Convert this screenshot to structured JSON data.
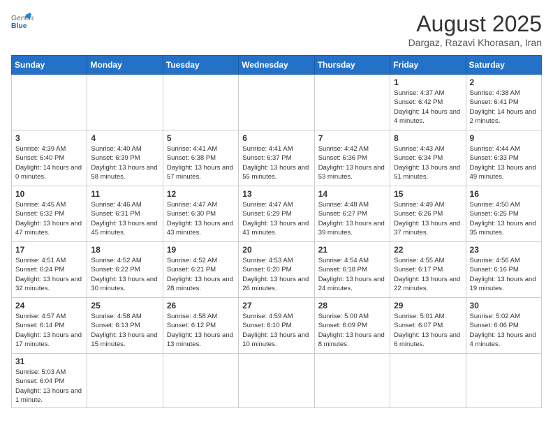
{
  "header": {
    "logo_general": "General",
    "logo_blue": "Blue",
    "title": "August 2025",
    "subtitle": "Dargaz, Razavi Khorasan, Iran"
  },
  "weekdays": [
    "Sunday",
    "Monday",
    "Tuesday",
    "Wednesday",
    "Thursday",
    "Friday",
    "Saturday"
  ],
  "weeks": [
    [
      {
        "day": "",
        "info": ""
      },
      {
        "day": "",
        "info": ""
      },
      {
        "day": "",
        "info": ""
      },
      {
        "day": "",
        "info": ""
      },
      {
        "day": "",
        "info": ""
      },
      {
        "day": "1",
        "info": "Sunrise: 4:37 AM\nSunset: 6:42 PM\nDaylight: 14 hours\nand 4 minutes."
      },
      {
        "day": "2",
        "info": "Sunrise: 4:38 AM\nSunset: 6:41 PM\nDaylight: 14 hours\nand 2 minutes."
      }
    ],
    [
      {
        "day": "3",
        "info": "Sunrise: 4:39 AM\nSunset: 6:40 PM\nDaylight: 14 hours\nand 0 minutes."
      },
      {
        "day": "4",
        "info": "Sunrise: 4:40 AM\nSunset: 6:39 PM\nDaylight: 13 hours\nand 58 minutes."
      },
      {
        "day": "5",
        "info": "Sunrise: 4:41 AM\nSunset: 6:38 PM\nDaylight: 13 hours\nand 57 minutes."
      },
      {
        "day": "6",
        "info": "Sunrise: 4:41 AM\nSunset: 6:37 PM\nDaylight: 13 hours\nand 55 minutes."
      },
      {
        "day": "7",
        "info": "Sunrise: 4:42 AM\nSunset: 6:36 PM\nDaylight: 13 hours\nand 53 minutes."
      },
      {
        "day": "8",
        "info": "Sunrise: 4:43 AM\nSunset: 6:34 PM\nDaylight: 13 hours\nand 51 minutes."
      },
      {
        "day": "9",
        "info": "Sunrise: 4:44 AM\nSunset: 6:33 PM\nDaylight: 13 hours\nand 49 minutes."
      }
    ],
    [
      {
        "day": "10",
        "info": "Sunrise: 4:45 AM\nSunset: 6:32 PM\nDaylight: 13 hours\nand 47 minutes."
      },
      {
        "day": "11",
        "info": "Sunrise: 4:46 AM\nSunset: 6:31 PM\nDaylight: 13 hours\nand 45 minutes."
      },
      {
        "day": "12",
        "info": "Sunrise: 4:47 AM\nSunset: 6:30 PM\nDaylight: 13 hours\nand 43 minutes."
      },
      {
        "day": "13",
        "info": "Sunrise: 4:47 AM\nSunset: 6:29 PM\nDaylight: 13 hours\nand 41 minutes."
      },
      {
        "day": "14",
        "info": "Sunrise: 4:48 AM\nSunset: 6:27 PM\nDaylight: 13 hours\nand 39 minutes."
      },
      {
        "day": "15",
        "info": "Sunrise: 4:49 AM\nSunset: 6:26 PM\nDaylight: 13 hours\nand 37 minutes."
      },
      {
        "day": "16",
        "info": "Sunrise: 4:50 AM\nSunset: 6:25 PM\nDaylight: 13 hours\nand 35 minutes."
      }
    ],
    [
      {
        "day": "17",
        "info": "Sunrise: 4:51 AM\nSunset: 6:24 PM\nDaylight: 13 hours\nand 32 minutes."
      },
      {
        "day": "18",
        "info": "Sunrise: 4:52 AM\nSunset: 6:22 PM\nDaylight: 13 hours\nand 30 minutes."
      },
      {
        "day": "19",
        "info": "Sunrise: 4:52 AM\nSunset: 6:21 PM\nDaylight: 13 hours\nand 28 minutes."
      },
      {
        "day": "20",
        "info": "Sunrise: 4:53 AM\nSunset: 6:20 PM\nDaylight: 13 hours\nand 26 minutes."
      },
      {
        "day": "21",
        "info": "Sunrise: 4:54 AM\nSunset: 6:18 PM\nDaylight: 13 hours\nand 24 minutes."
      },
      {
        "day": "22",
        "info": "Sunrise: 4:55 AM\nSunset: 6:17 PM\nDaylight: 13 hours\nand 22 minutes."
      },
      {
        "day": "23",
        "info": "Sunrise: 4:56 AM\nSunset: 6:16 PM\nDaylight: 13 hours\nand 19 minutes."
      }
    ],
    [
      {
        "day": "24",
        "info": "Sunrise: 4:57 AM\nSunset: 6:14 PM\nDaylight: 13 hours\nand 17 minutes."
      },
      {
        "day": "25",
        "info": "Sunrise: 4:58 AM\nSunset: 6:13 PM\nDaylight: 13 hours\nand 15 minutes."
      },
      {
        "day": "26",
        "info": "Sunrise: 4:58 AM\nSunset: 6:12 PM\nDaylight: 13 hours\nand 13 minutes."
      },
      {
        "day": "27",
        "info": "Sunrise: 4:59 AM\nSunset: 6:10 PM\nDaylight: 13 hours\nand 10 minutes."
      },
      {
        "day": "28",
        "info": "Sunrise: 5:00 AM\nSunset: 6:09 PM\nDaylight: 13 hours\nand 8 minutes."
      },
      {
        "day": "29",
        "info": "Sunrise: 5:01 AM\nSunset: 6:07 PM\nDaylight: 13 hours\nand 6 minutes."
      },
      {
        "day": "30",
        "info": "Sunrise: 5:02 AM\nSunset: 6:06 PM\nDaylight: 13 hours\nand 4 minutes."
      }
    ],
    [
      {
        "day": "31",
        "info": "Sunrise: 5:03 AM\nSunset: 6:04 PM\nDaylight: 13 hours\nand 1 minute."
      },
      {
        "day": "",
        "info": ""
      },
      {
        "day": "",
        "info": ""
      },
      {
        "day": "",
        "info": ""
      },
      {
        "day": "",
        "info": ""
      },
      {
        "day": "",
        "info": ""
      },
      {
        "day": "",
        "info": ""
      }
    ]
  ]
}
